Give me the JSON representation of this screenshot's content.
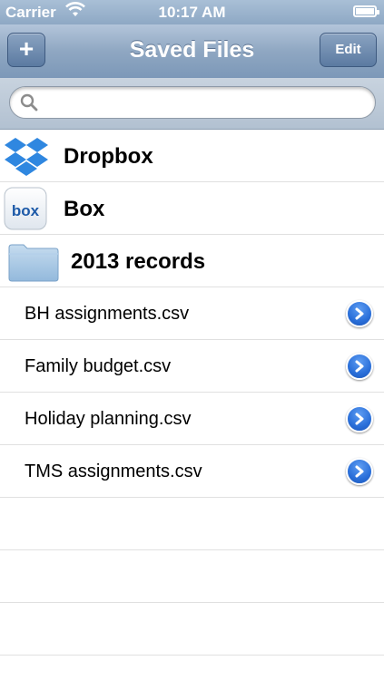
{
  "status_bar": {
    "carrier": "Carrier",
    "time": "10:17 AM"
  },
  "nav_bar": {
    "title": "Saved Files",
    "add_label": "+",
    "edit_label": "Edit"
  },
  "search": {
    "placeholder": "",
    "value": ""
  },
  "locations": [
    {
      "label": "Dropbox",
      "icon": "dropbox-icon"
    },
    {
      "label": "Box",
      "icon": "box-icon"
    },
    {
      "label": "2013 records",
      "icon": "folder-icon"
    }
  ],
  "files": [
    {
      "label": "BH assignments.csv"
    },
    {
      "label": "Family budget.csv"
    },
    {
      "label": "Holiday planning.csv"
    },
    {
      "label": "TMS assignments.csv"
    }
  ],
  "colors": {
    "nav_blue": "#8fa7c2",
    "dropbox_blue": "#2f87e0",
    "disclosure_blue": "#2a6fd9",
    "folder_blue": "#a6c8e6"
  }
}
